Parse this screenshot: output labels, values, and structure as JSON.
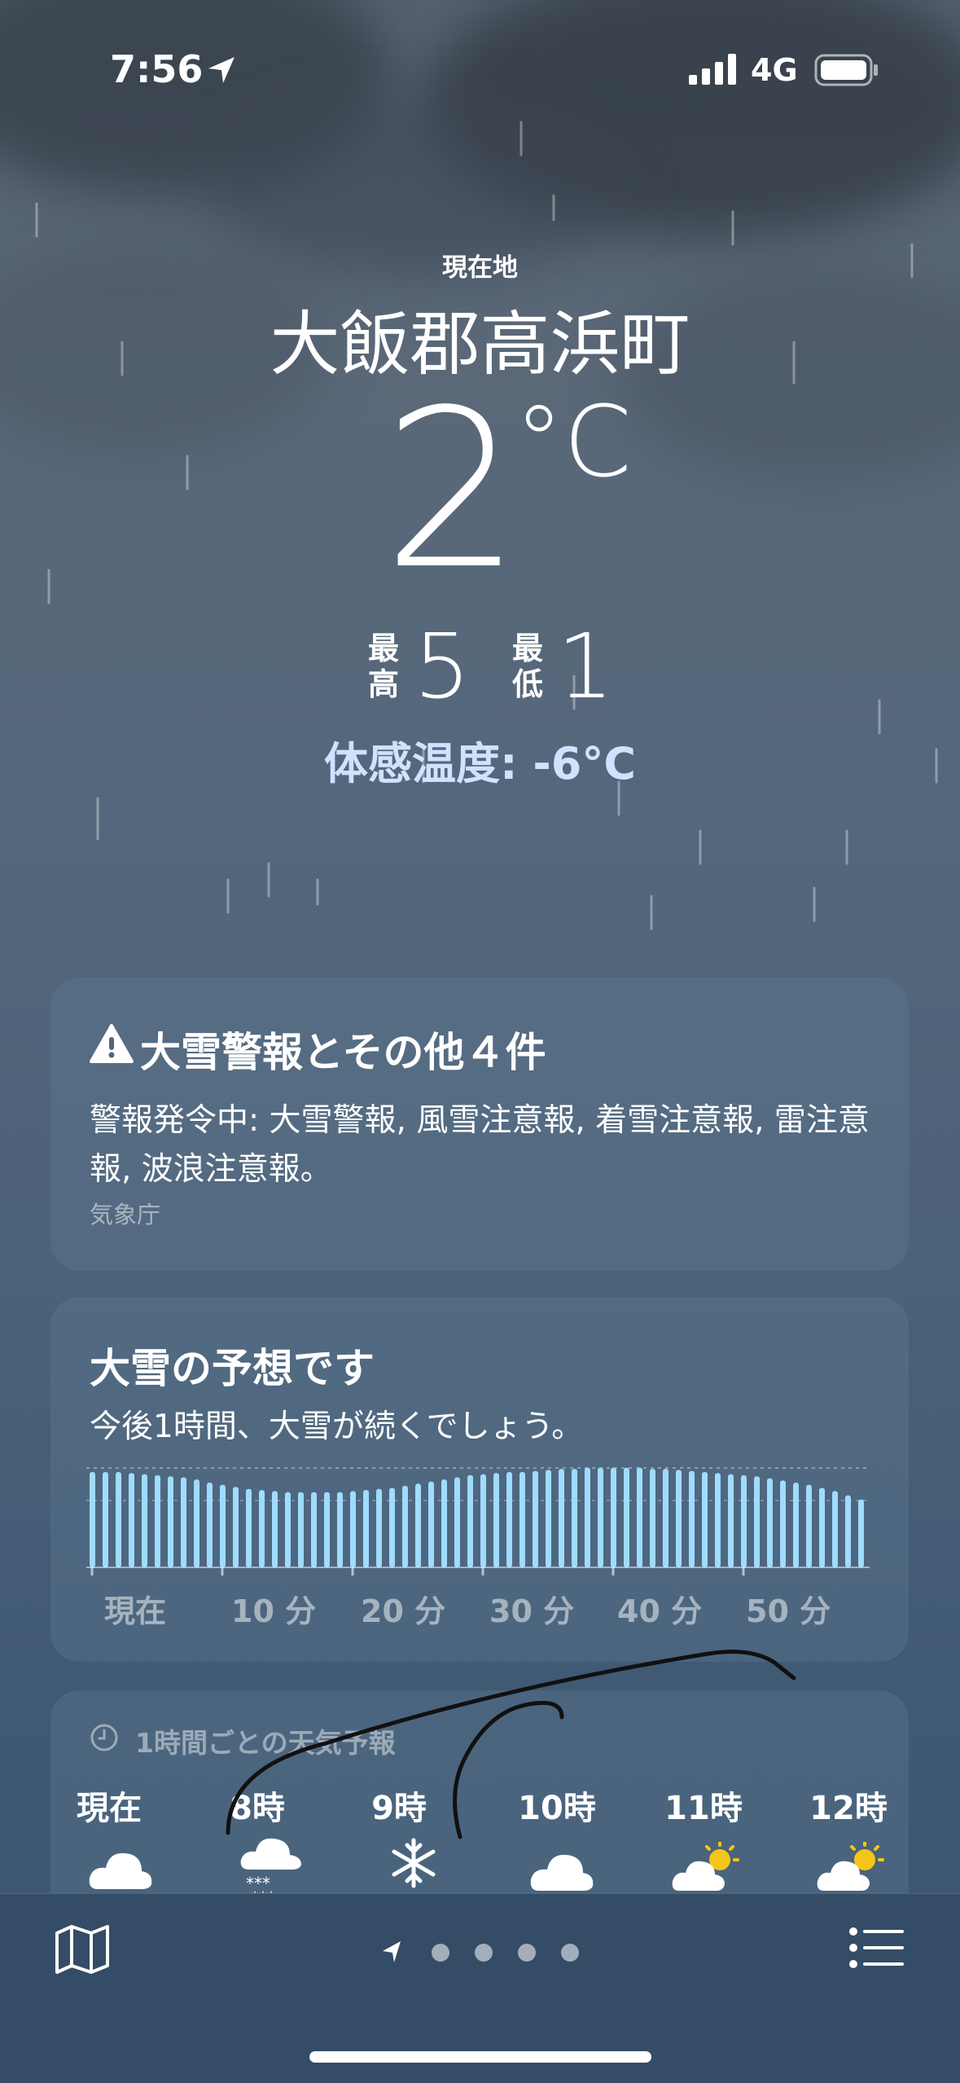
{
  "status_bar": {
    "time": "7:56",
    "network": "4G"
  },
  "header": {
    "current_location_label": "現在地",
    "city": "大飯郡高浜町",
    "temperature": "2",
    "temperature_unit": "°C",
    "high_label": "最高",
    "high_value": "5",
    "low_label": "最低",
    "low_value": "1",
    "feels_like": "体感温度: -6°C"
  },
  "alert_card": {
    "title": "大雪警報とその他４件",
    "body": "警報発令中: 大雪警報, 風雪注意報, 着雪注意報, 雷注意報, 波浪注意報。",
    "source": "気象庁"
  },
  "precip_card": {
    "title": "大雪の予想です",
    "subtitle": "今後1時間、大雪が続くでしょう。",
    "axis_labels": [
      "現在",
      "10 分",
      "20 分",
      "30 分",
      "40 分",
      "50 分"
    ]
  },
  "chart_data": {
    "type": "bar",
    "title": "大雪の予想です",
    "xlabel": "",
    "ylabel": "",
    "x_ticks": [
      "現在",
      "10 分",
      "20 分",
      "30 分",
      "40 分",
      "50 分"
    ],
    "values": [
      0.9,
      0.9,
      0.9,
      0.89,
      0.88,
      0.87,
      0.86,
      0.85,
      0.83,
      0.8,
      0.78,
      0.76,
      0.74,
      0.73,
      0.72,
      0.71,
      0.71,
      0.71,
      0.71,
      0.71,
      0.72,
      0.73,
      0.74,
      0.75,
      0.77,
      0.79,
      0.81,
      0.83,
      0.85,
      0.87,
      0.88,
      0.89,
      0.9,
      0.9,
      0.91,
      0.92,
      0.93,
      0.93,
      0.94,
      0.94,
      0.94,
      0.94,
      0.94,
      0.93,
      0.93,
      0.92,
      0.91,
      0.9,
      0.89,
      0.88,
      0.87,
      0.86,
      0.84,
      0.82,
      0.8,
      0.78,
      0.75,
      0.72,
      0.68,
      0.64
    ]
  },
  "hourly_card": {
    "header": "1時間ごとの天気予報",
    "hours": [
      {
        "label": "現在",
        "icon": "cloud-icon"
      },
      {
        "label": "8時",
        "icon": "snow-cloud-icon"
      },
      {
        "label": "9時",
        "icon": "snowflake-icon"
      },
      {
        "label": "10時",
        "icon": "cloud-icon"
      },
      {
        "label": "11時",
        "icon": "partly-sunny-icon"
      },
      {
        "label": "12時",
        "icon": "partly-sunny-icon"
      }
    ]
  },
  "colors": {
    "bar": "#9fdcff",
    "feels_like": "#cfe3ff",
    "sun": "#f5c518"
  }
}
